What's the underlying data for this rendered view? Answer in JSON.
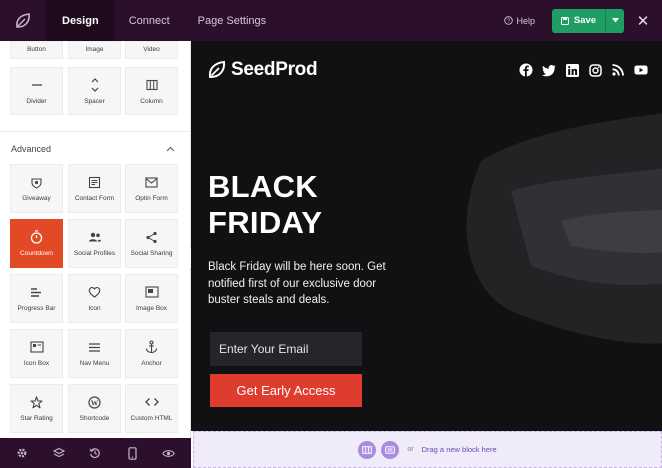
{
  "topbar": {
    "tabs": [
      "Design",
      "Connect",
      "Page Settings"
    ],
    "help_label": "Help",
    "save_label": "Save",
    "close_glyph": "✕"
  },
  "sidebar": {
    "top_blocks_partial": [
      "Button",
      "Image",
      "Video"
    ],
    "layout_blocks": [
      "Divider",
      "Spacer",
      "Column"
    ],
    "section_title": "Advanced",
    "advanced_blocks": [
      [
        "Giveaway",
        "Contact Form",
        "Optin Form"
      ],
      [
        "Countdown",
        "Social Profiles",
        "Social Sharing"
      ],
      [
        "Progress Bar",
        "Icon",
        "Image Box"
      ],
      [
        "Icon Box",
        "Nav Menu",
        "Anchor"
      ],
      [
        "Star Rating",
        "Shortcode",
        "Custom HTML"
      ]
    ],
    "active_block": "Countdown"
  },
  "bottombar": {
    "icons": [
      "settings-icon",
      "layers-icon",
      "history-icon",
      "mobile-icon",
      "preview-eye-icon"
    ]
  },
  "preview": {
    "brand": "SeedProd",
    "social_icons": [
      "facebook-icon",
      "twitter-icon",
      "linkedin-icon",
      "instagram-icon",
      "rss-icon",
      "youtube-icon"
    ],
    "headline_line1": "BLACK",
    "headline_line2": "FRIDAY",
    "subtext": "Black Friday will be here soon. Get notified first of our exclusive door buster steals and deals.",
    "email_placeholder": "Enter Your Email",
    "cta_label": "Get Early Access"
  },
  "dropzone": {
    "or_label": "or",
    "text": "Drag a new block here"
  },
  "colors": {
    "topbar_bg": "#2c0f2b",
    "save_green": "#1f9e63",
    "accent_orange": "#e24a26",
    "cta_red": "#e03b2f",
    "preview_bg": "#111113",
    "dropzone_purple": "#a88cdf"
  }
}
